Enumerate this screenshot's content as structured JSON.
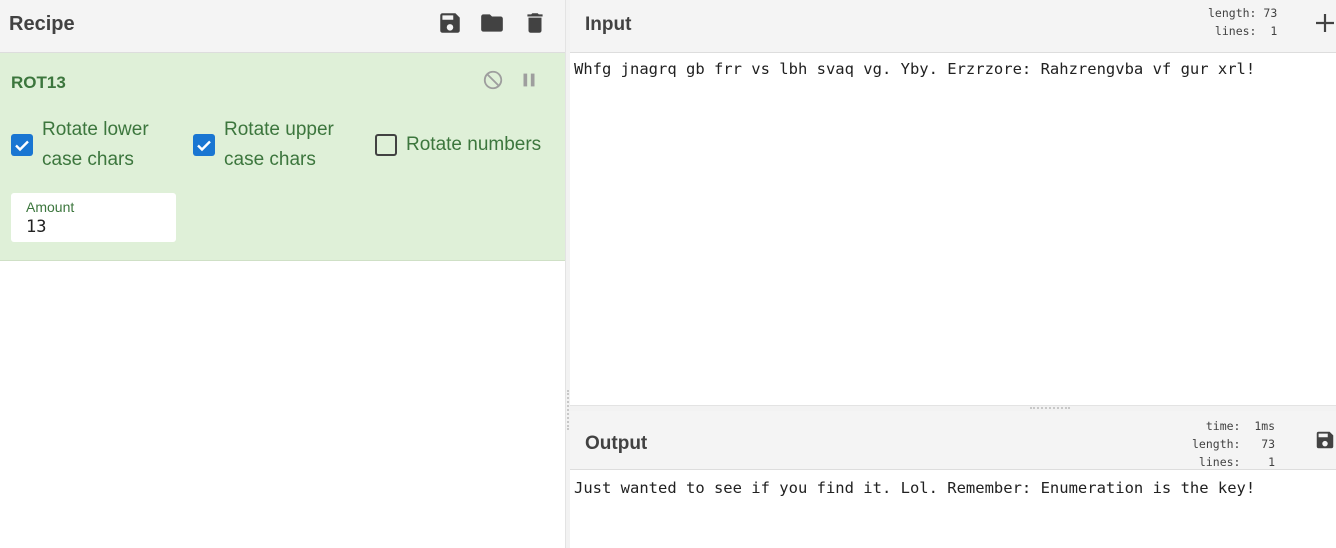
{
  "recipe": {
    "title": "Recipe",
    "icons": [
      "save-icon",
      "folder-icon",
      "trash-icon"
    ]
  },
  "operation": {
    "name": "ROT13",
    "controls": [
      "disable-icon",
      "pause-icon"
    ],
    "options": [
      {
        "label": "Rotate lower case chars",
        "line1": "Rotate lower",
        "line2": "case chars",
        "checked": true
      },
      {
        "label": "Rotate upper case chars",
        "line1": "Rotate upper",
        "line2": "case chars",
        "checked": true
      },
      {
        "label": "Rotate numbers",
        "checked": false
      }
    ],
    "amount": {
      "label": "Amount",
      "value": "13"
    }
  },
  "input": {
    "title": "Input",
    "stats": {
      "length_label": "length:",
      "length": "73",
      "lines_label": "lines:",
      "lines": "1"
    },
    "text": "Whfg jnagrq gb frr vs lbh svaq vg. Yby. Erzrzore: Rahzrengvba vf gur xrl!"
  },
  "output": {
    "title": "Output",
    "stats": {
      "time_label": "time:",
      "time": "1ms",
      "length_label": "length:",
      "length": "73",
      "lines_label": "lines:",
      "lines": "1"
    },
    "text": "Just wanted to see if you find it. Lol. Remember: Enumeration is the key!"
  },
  "colors": {
    "accent": "#1976d2",
    "op_bg": "#dff0d8",
    "op_text": "#3c763d"
  }
}
